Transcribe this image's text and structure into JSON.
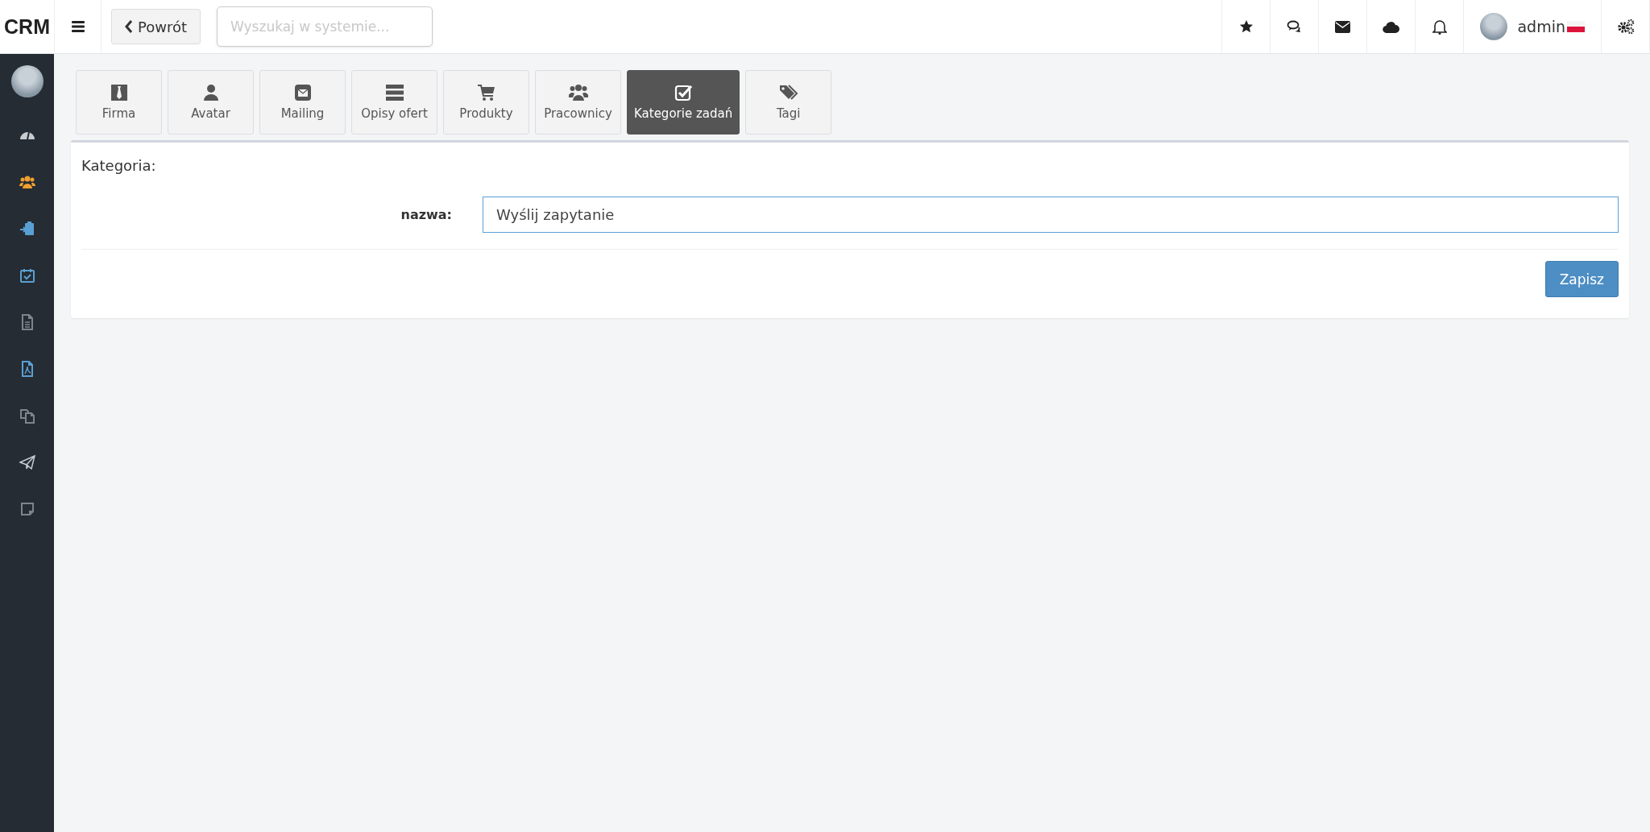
{
  "brand": "CRM",
  "back_button": {
    "label": "Powrót"
  },
  "search": {
    "placeholder": "Wyszukaj w systemie..."
  },
  "user": {
    "name": "admin"
  },
  "sidebar": {
    "items": [
      {
        "kind": "gauge",
        "color": "#c8ccd0"
      },
      {
        "kind": "users",
        "color": "#f0a030"
      },
      {
        "kind": "clipboard",
        "color": "#5a9fd4"
      },
      {
        "kind": "calendar",
        "color": "#5a9fd4"
      },
      {
        "kind": "file",
        "color": "#7d858c"
      },
      {
        "kind": "pdf",
        "color": "#5a9fd4"
      },
      {
        "kind": "copy",
        "color": "#7d858c"
      },
      {
        "kind": "plane",
        "color": "#c8ccd0"
      },
      {
        "kind": "note",
        "color": "#7d858c"
      }
    ]
  },
  "tabs": [
    {
      "kind": "tie",
      "label": "Firma",
      "selected": false
    },
    {
      "kind": "user",
      "label": "Avatar",
      "selected": false
    },
    {
      "kind": "mail",
      "label": "Mailing",
      "selected": false
    },
    {
      "kind": "server",
      "label": "Opisy ofert",
      "selected": false
    },
    {
      "kind": "cart",
      "label": "Produkty",
      "selected": false
    },
    {
      "kind": "users",
      "label": "Pracownicy",
      "selected": false
    },
    {
      "kind": "check",
      "label": "Kategorie zadań",
      "selected": true
    },
    {
      "kind": "tags",
      "label": "Tagi",
      "selected": false
    }
  ],
  "form": {
    "title": "Kategoria:",
    "field_label": "nazwa:",
    "field_value": "Wyślij zapytanie",
    "save_button": "Zapisz"
  }
}
